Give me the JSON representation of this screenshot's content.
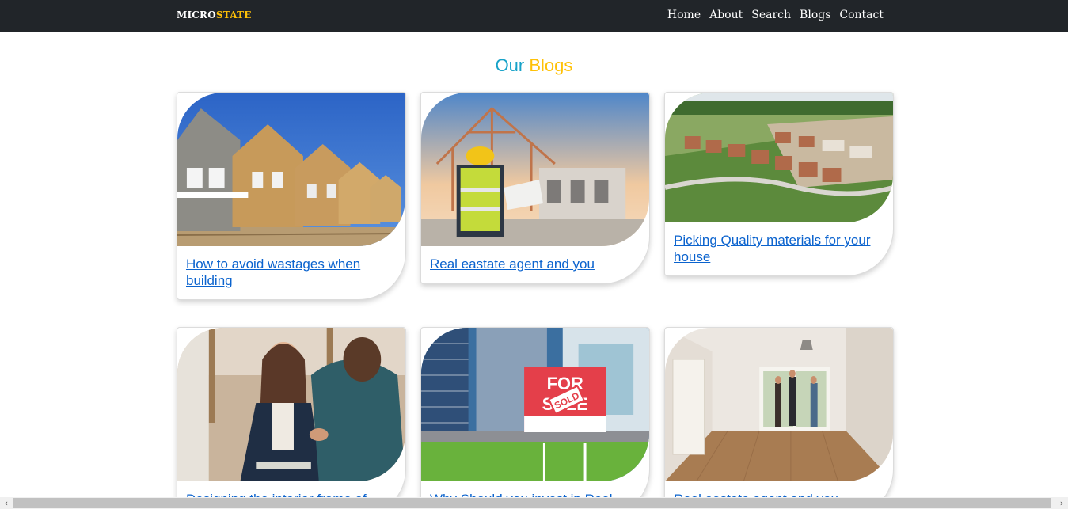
{
  "brand": {
    "part1": "MICRO",
    "part2": "STATE"
  },
  "nav": {
    "items": [
      "Home",
      "About",
      "Search",
      "Blogs",
      "Contact"
    ]
  },
  "heading": {
    "part1": "Our",
    "part2": "Blogs"
  },
  "cards": [
    {
      "title": "How to avoid wastages when building",
      "image": "houses-under-construction"
    },
    {
      "title": "Real eastate agent and you",
      "image": "construction-worker-with-plans"
    },
    {
      "title": "Picking Quality materials for your house",
      "image": "aerial-housing-development"
    },
    {
      "title": "Designing the interior frame of your",
      "image": "business-handshake"
    },
    {
      "title": "Why Should you invest in Real",
      "image": "for-sale-sold-sign"
    },
    {
      "title": "Real eastate agent and you",
      "image": "empty-room-viewing"
    }
  ],
  "scrollbar": {
    "left_icon": "‹",
    "right_icon": "›"
  }
}
